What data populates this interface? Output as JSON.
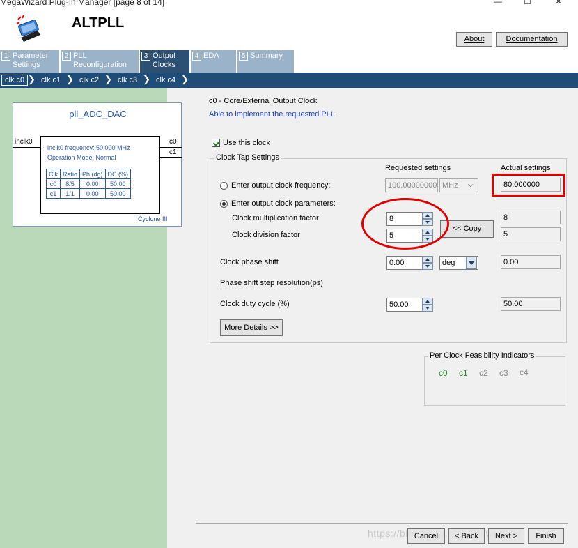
{
  "window": {
    "title": "MegaWizard Plug-In Manager [page 8 of 14]",
    "controls": {
      "minimize": "—",
      "maximize": "☐",
      "close": "✕"
    }
  },
  "header": {
    "app_title": "ALTPLL",
    "about_label": "About",
    "documentation_label": "Documentation"
  },
  "tabs": [
    {
      "num": "1",
      "label_line1": "Parameter",
      "label_line2": "Settings"
    },
    {
      "num": "2",
      "label_line1": "PLL",
      "label_line2": "Reconfiguration"
    },
    {
      "num": "3",
      "label_line1": "Output",
      "label_line2": "Clocks"
    },
    {
      "num": "4",
      "label_line1": "EDA",
      "label_line2": ""
    },
    {
      "num": "5",
      "label_line1": "Summary",
      "label_line2": ""
    }
  ],
  "subtabs": [
    "clk c0",
    "clk c1",
    "clk c2",
    "clk c3",
    "clk c4"
  ],
  "pll_diagram": {
    "name": "pll_ADC_DAC",
    "input": "inclk0",
    "outputs": [
      "c0",
      "c1"
    ],
    "info_line1": "inclk0 frequency: 50.000 MHz",
    "info_line2": "Operation Mode: Normal",
    "table_headers": [
      "Clk",
      "Ratio",
      "Ph (dg)",
      "DC (%)"
    ],
    "table_rows": [
      [
        "c0",
        "8/5",
        "0.00",
        "50.00"
      ],
      [
        "c1",
        "1/1",
        "0.00",
        "50.00"
      ]
    ],
    "device": "Cyclone III"
  },
  "main": {
    "section_title": "c0 - Core/External Output Clock",
    "status": "Able to implement the requested PLL",
    "use_clock_label": "Use this clock",
    "group_title": "Clock Tap Settings",
    "requested_header": "Requested settings",
    "actual_header": "Actual settings",
    "freq_radio_label": "Enter output clock frequency:",
    "freq_value": "100.00000000",
    "freq_unit": "MHz",
    "freq_actual": "80.000000",
    "params_radio_label": "Enter output clock parameters:",
    "mult_label": "Clock multiplication factor",
    "mult_value": "8",
    "mult_actual": "8",
    "div_label": "Clock division factor",
    "div_value": "5",
    "div_actual": "5",
    "copy_label": "<< Copy",
    "phase_label": "Clock phase shift",
    "phase_value": "0.00",
    "phase_unit": "deg",
    "phase_actual": "0.00",
    "phase_res_label": "Phase shift step resolution(ps)",
    "duty_label": "Clock duty cycle (%)",
    "duty_value": "50.00",
    "duty_actual": "50.00",
    "more_details_label": "More Details >>"
  },
  "feasibility": {
    "title": "Per Clock Feasibility Indicators",
    "clocks": [
      "c0",
      "c1",
      "c2",
      "c3",
      "c4"
    ],
    "active_color": "#1a8a1a",
    "inactive_color": "#8a8a8a"
  },
  "footer": {
    "cancel_label": "Cancel",
    "back_label": "< Back",
    "next_label": "Next >",
    "finish_label": "Finish",
    "watermark": "https://blog.csdn.net/Hhwwb1997"
  }
}
